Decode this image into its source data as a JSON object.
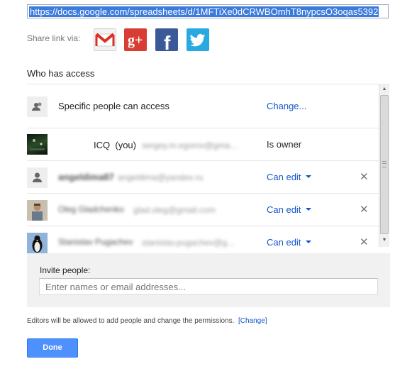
{
  "link": {
    "url": "https://docs.google.com/spreadsheets/d/1MFTiXe0dCRWBOmhT8nypcsO3oqas5392"
  },
  "share": {
    "label": "Share link via:",
    "icons": [
      "gmail-icon",
      "google-plus-icon",
      "facebook-icon",
      "twitter-icon"
    ],
    "gplus_text": "g+",
    "fb_text": "f"
  },
  "access": {
    "title": "Who has access",
    "visibility": {
      "label": "Specific people can access",
      "change": "Change..."
    },
    "people": [
      {
        "name": "ICQ",
        "you": "(you)",
        "email": "sergey.m.egorov@gma...",
        "role": "Is owner"
      },
      {
        "name": "angeldima87",
        "email": "angeldima@yandex.ru",
        "role": "Can edit",
        "remove": "✕"
      },
      {
        "name": "Oleg Gladchenko",
        "email": "glad.oleg@gmail.com",
        "role": "Can edit",
        "remove": "✕"
      },
      {
        "name": "Stanislav Pugachev",
        "email": "stanislav.pugachev@g...",
        "role": "Can edit",
        "remove": "✕"
      }
    ]
  },
  "invite": {
    "label": "Invite people:",
    "placeholder": "Enter names or email addresses..."
  },
  "note": {
    "text": "Editors will be allowed to add people and change the permissions.",
    "link": "[Change]"
  },
  "done_label": "Done",
  "colors": {
    "accent": "#4d90fe",
    "link": "#1155cc"
  }
}
